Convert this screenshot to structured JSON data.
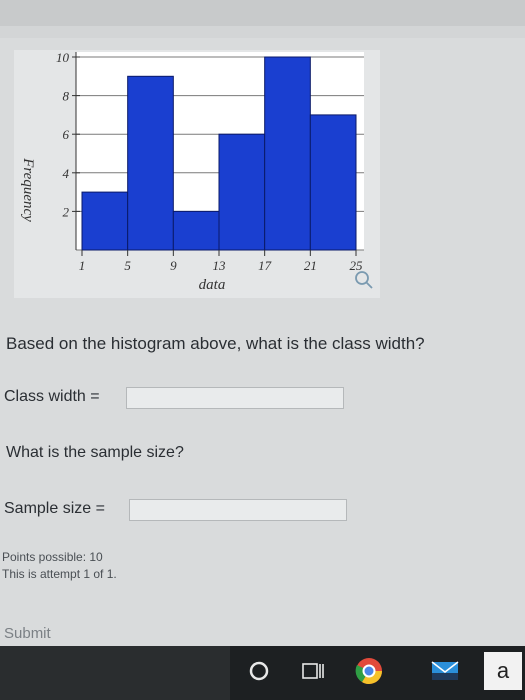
{
  "chart_data": {
    "type": "bar",
    "title": "",
    "xlabel": "data",
    "ylabel": "Frequency",
    "x_ticks": [
      1,
      5,
      9,
      13,
      17,
      21,
      25
    ],
    "y_ticks": [
      2,
      4,
      6,
      8,
      10
    ],
    "ylim": [
      0,
      10
    ],
    "xlim": [
      1,
      25
    ],
    "bins": [
      {
        "start": 1,
        "end": 5,
        "value": 3
      },
      {
        "start": 5,
        "end": 9,
        "value": 9
      },
      {
        "start": 9,
        "end": 13,
        "value": 2
      },
      {
        "start": 13,
        "end": 17,
        "value": 6
      },
      {
        "start": 17,
        "end": 21,
        "value": 10
      },
      {
        "start": 21,
        "end": 25,
        "value": 7
      }
    ],
    "grid": true,
    "colors": {
      "bar": "#1a3fd0",
      "bar_edge": "#0a1a6a",
      "plot_bg": "#ffffff",
      "grid": "#7a7a7a"
    }
  },
  "zoom_icon": "magnifier-icon",
  "questions": {
    "q1": "Based on the histogram above, what is the class width?",
    "q1_label": "Class width =",
    "q2": "What is the sample size?",
    "q2_label": "Sample size ="
  },
  "meta": {
    "points": "Points possible: 10",
    "attempt": "This is attempt 1 of 1."
  },
  "submit_label": "Submit",
  "taskbar": {
    "icons": [
      "cortana-circle-icon",
      "task-view-icon",
      "chrome-icon",
      "mail-icon",
      "amazon-icon"
    ],
    "amazon_letter": "a"
  }
}
